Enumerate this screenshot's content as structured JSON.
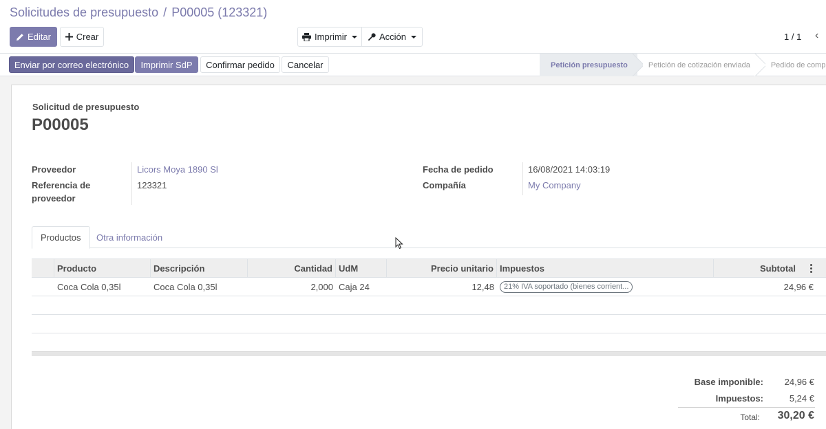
{
  "breadcrumb": {
    "parent": "Solicitudes de presupuesto",
    "separator": "/",
    "current": "P00005 (123321)"
  },
  "toolbar": {
    "edit_label": "Editar",
    "create_label": "Crear",
    "print_label": "Imprimir",
    "action_label": "Acción",
    "pager": "1 / 1",
    "prev_glyph": "‹"
  },
  "statusbar": {
    "buttons": {
      "send_email": "Enviar por correo electrónico",
      "print_sdp": "Imprimir SdP",
      "confirm_order": "Confirmar pedido",
      "cancel": "Cancelar"
    },
    "stages": [
      {
        "label": "Petición presupuesto",
        "active": true
      },
      {
        "label": "Petición de cotización enviada",
        "active": false
      },
      {
        "label": "Pedido de compra",
        "active": false
      }
    ]
  },
  "form": {
    "doc_label": "Solicitud de presupuesto",
    "doc_name": "P00005",
    "left_fields": {
      "vendor_label": "Proveedor",
      "vendor_value": "Licors Moya 1890 Sl",
      "vendor_ref_label_1": "Referencia de",
      "vendor_ref_label_2": "proveedor",
      "vendor_ref_value": "123321"
    },
    "right_fields": {
      "order_date_label": "Fecha de pedido",
      "order_date_value": "16/08/2021 14:03:19",
      "company_label": "Compañía",
      "company_value": "My Company"
    }
  },
  "tabs": [
    {
      "label": "Productos",
      "active": true
    },
    {
      "label": "Otra información",
      "active": false
    }
  ],
  "table": {
    "headers": {
      "product": "Producto",
      "description": "Descripción",
      "quantity": "Cantidad",
      "uom": "UdM",
      "unit_price": "Precio unitario",
      "taxes": "Impuestos",
      "subtotal": "Subtotal"
    },
    "rows": [
      {
        "product": "Coca Cola 0,35l",
        "description": "Coca Cola 0,35l",
        "quantity": "2,000",
        "uom": "Caja 24",
        "unit_price": "12,48",
        "taxes": "21% IVA soportado (bienes corrient...",
        "subtotal": "24,96 €"
      }
    ]
  },
  "totals": {
    "untaxed_label": "Base imponible:",
    "untaxed_value": "24,96 €",
    "taxes_label": "Impuestos:",
    "taxes_value": "5,24 €",
    "total_label": "Total:",
    "total_value": "30,20 €"
  }
}
